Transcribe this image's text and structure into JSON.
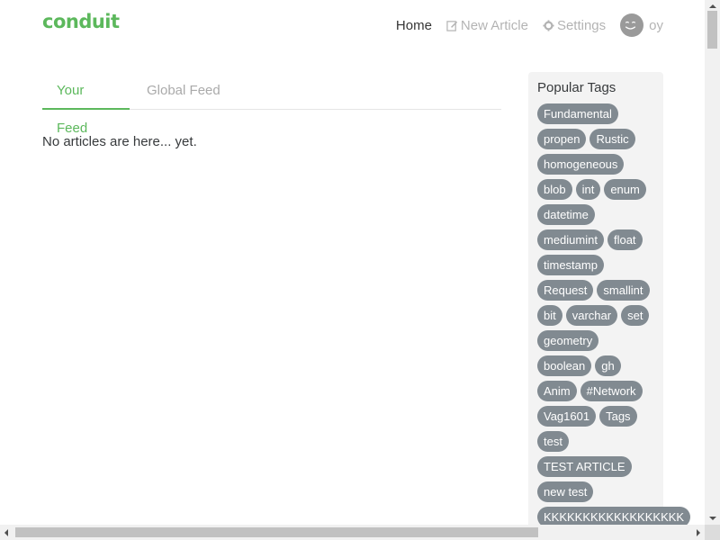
{
  "navbar": {
    "brand": "conduit",
    "home": "Home",
    "new_article": "New Article",
    "settings": "Settings",
    "username": "oy"
  },
  "feed": {
    "tabs": [
      {
        "label": "Your Feed",
        "active": true
      },
      {
        "label": "Global Feed",
        "active": false
      }
    ],
    "empty_message": "No articles are here... yet."
  },
  "sidebar": {
    "title": "Popular Tags",
    "tags": [
      "Fundamental",
      "propen",
      "Rustic",
      "homogeneous",
      "blob",
      "int",
      "enum",
      "datetime",
      "mediumint",
      "float",
      "timestamp",
      "Request",
      "smallint",
      "bit",
      "varchar",
      "set",
      "geometry",
      "boolean",
      "gh",
      "Anim",
      "#Network",
      "Vag1601",
      "Tags",
      "test",
      "TEST ARTICLE",
      "new test",
      "KKKKKKKKKKKKKKKKKK"
    ]
  },
  "colors": {
    "brand": "#5cb85c",
    "tag_bg": "#818a91",
    "sidebar_bg": "#f3f3f3"
  }
}
